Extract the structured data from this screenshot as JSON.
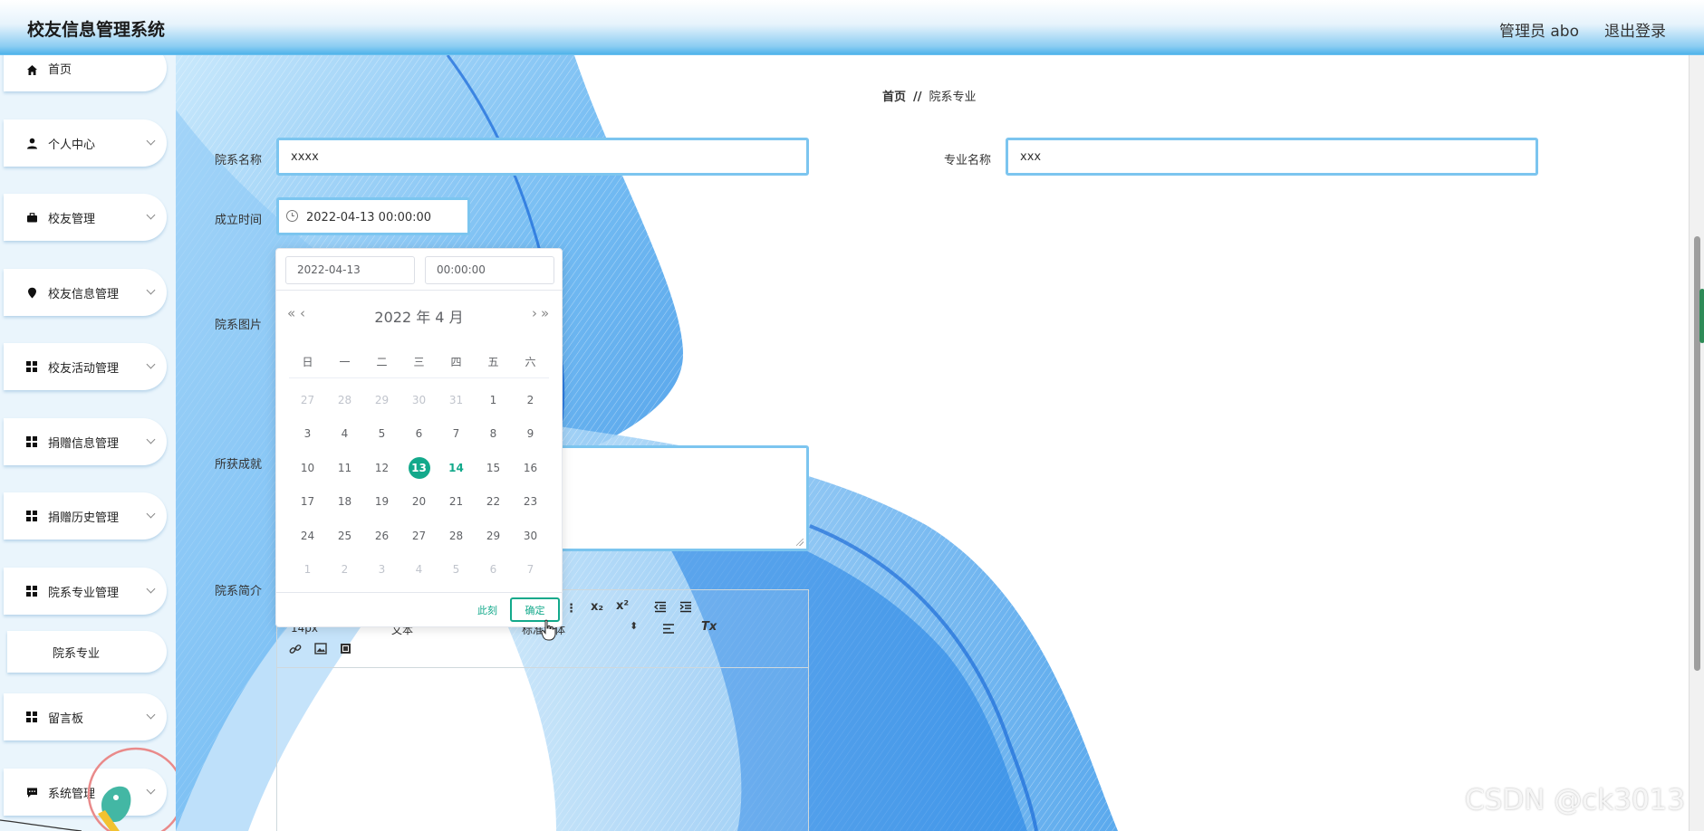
{
  "header": {
    "app_title": "校友信息管理系统",
    "user_info": "管理员 abo",
    "logout": "退出登录"
  },
  "sidebar": {
    "items": [
      {
        "label": "首页",
        "icon": "home-icon"
      },
      {
        "label": "个人中心",
        "icon": "user-icon"
      },
      {
        "label": "校友管理",
        "icon": "briefcase-icon"
      },
      {
        "label": "校友信息管理",
        "icon": "pin-icon"
      },
      {
        "label": "校友活动管理",
        "icon": "grid-icon"
      },
      {
        "label": "捐赠信息管理",
        "icon": "grid-icon"
      },
      {
        "label": "捐赠历史管理",
        "icon": "grid-icon"
      },
      {
        "label": "院系专业管理",
        "icon": "grid-icon"
      },
      {
        "label": "留言板",
        "icon": "grid-icon"
      },
      {
        "label": "系统管理",
        "icon": "chat-icon"
      }
    ],
    "active_sub_item": "院系专业"
  },
  "breadcrumb": {
    "home": "首页",
    "separator": "//",
    "current": "院系专业"
  },
  "form": {
    "dept_name_label": "院系名称",
    "dept_name_value": "xxxx",
    "major_name_label": "专业名称",
    "major_name_value": "xxx",
    "founded_label": "成立时间",
    "founded_value": "2022-04-13 00:00:00",
    "image_label": "院系图片",
    "achievements_label": "所获成就",
    "intro_label": "院系简介"
  },
  "editor": {
    "font_size": "14px",
    "text_style": "文本",
    "font_family": "标准字体"
  },
  "date_picker": {
    "date_input": "2022-04-13",
    "time_input": "00:00:00",
    "month_title": "2022 年  4 月",
    "weekdays": [
      "日",
      "一",
      "二",
      "三",
      "四",
      "五",
      "六"
    ],
    "weeks": [
      [
        "27",
        "28",
        "29",
        "30",
        "31",
        "1",
        "2"
      ],
      [
        "3",
        "4",
        "5",
        "6",
        "7",
        "8",
        "9"
      ],
      [
        "10",
        "11",
        "12",
        "13",
        "14",
        "15",
        "16"
      ],
      [
        "17",
        "18",
        "19",
        "20",
        "21",
        "22",
        "23"
      ],
      [
        "24",
        "25",
        "26",
        "27",
        "28",
        "29",
        "30"
      ],
      [
        "1",
        "2",
        "3",
        "4",
        "5",
        "6",
        "7"
      ]
    ],
    "selected_day": "13",
    "today_day": "14",
    "now_button": "此刻",
    "confirm_button": "确定",
    "accent_color": "#13a98b"
  },
  "watermark": "CSDN @ck3013"
}
